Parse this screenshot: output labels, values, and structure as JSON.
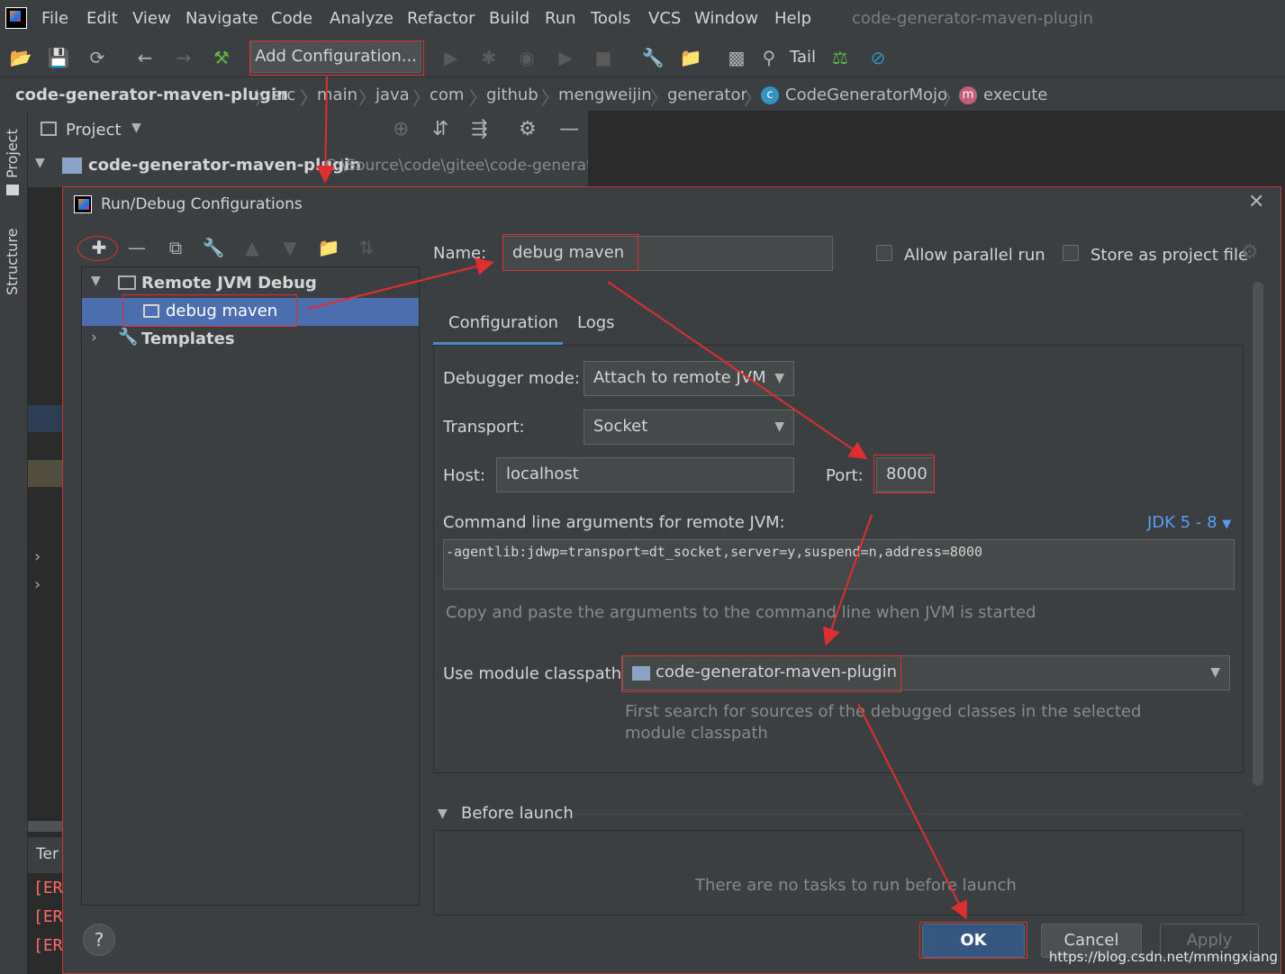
{
  "menubar": {
    "items": [
      "File",
      "Edit",
      "View",
      "Navigate",
      "Code",
      "Analyze",
      "Refactor",
      "Build",
      "Run",
      "Tools",
      "VCS",
      "Window",
      "Help"
    ],
    "window_title": "code-generator-maven-plugin"
  },
  "toolbar": {
    "add_configuration_label": "Add Configuration...",
    "tail_label": "Tail"
  },
  "breadcrumb": {
    "items": [
      "code-generator-maven-plugin",
      "src",
      "main",
      "java",
      "com",
      "github",
      "mengweijin",
      "generator",
      "CodeGeneratorMojo",
      "execute"
    ]
  },
  "sidebar": {
    "project_tab": "Project",
    "structure_tab": "Structure"
  },
  "project_panel": {
    "title": "Project",
    "root_name": "code-generator-maven-plugin",
    "root_path": "C:\\Source\\code\\gitee\\code-generat"
  },
  "terminal": {
    "tab_label": "Ter",
    "lines": [
      "[ER",
      "[ER",
      "[ER"
    ]
  },
  "dialog": {
    "title": "Run/Debug Configurations",
    "tree": {
      "group_label": "Remote JVM Debug",
      "config_label": "debug maven",
      "templates_label": "Templates"
    },
    "name_label": "Name:",
    "name_value": "debug maven",
    "allow_parallel_label": "Allow parallel run",
    "store_as_project_label": "Store as project file",
    "tabs": [
      "Configuration",
      "Logs"
    ],
    "debugger_mode_label": "Debugger mode:",
    "debugger_mode_value": "Attach to remote JVM",
    "transport_label": "Transport:",
    "transport_value": "Socket",
    "host_label": "Host:",
    "host_value": "localhost",
    "port_label": "Port:",
    "port_value": "8000",
    "cmd_args_label": "Command line arguments for remote JVM:",
    "jdk_link": "JDK 5 - 8",
    "cmd_args_value": "-agentlib:jdwp=transport=dt_socket,server=y,suspend=n,address=8000",
    "cmd_hint": "Copy and paste the arguments to the command line when JVM is started",
    "module_classpath_label": "Use module classpath:",
    "module_classpath_value": "code-generator-maven-plugin",
    "module_hint_line1": "First search for sources of the debugged classes in the selected",
    "module_hint_line2": "module classpath",
    "before_launch_label": "Before launch",
    "no_tasks_text": "There are no tasks to run before launch",
    "ok_label": "OK",
    "cancel_label": "Cancel",
    "apply_label": "Apply",
    "help_label": "?"
  },
  "watermark": "https://blog.csdn.net/mmingxiang",
  "colors": {
    "background": "#2b2b2b",
    "panel": "#3c3f41",
    "selection": "#4b6eaf",
    "accent_link": "#589df6",
    "annotation_red": "#e02d2d",
    "primary_button": "#365880"
  }
}
